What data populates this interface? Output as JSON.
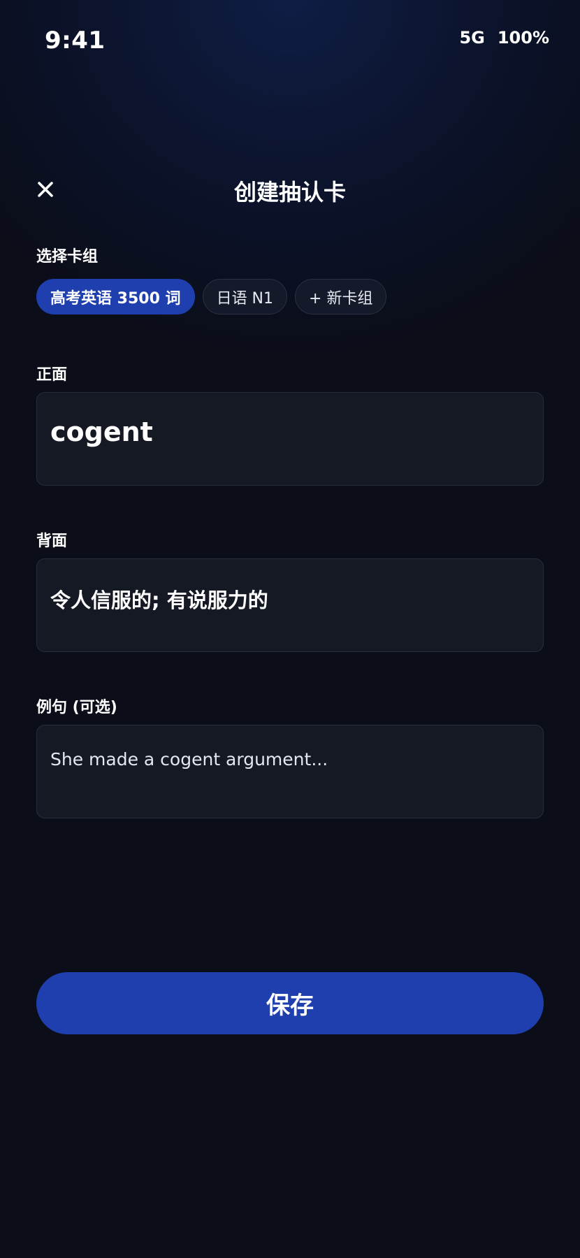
{
  "status_bar": {
    "time": "9:41",
    "network": "5G",
    "battery": "100%"
  },
  "header": {
    "close_icon": "close-icon",
    "title": "创建抽认卡"
  },
  "deck_section": {
    "label": "选择卡组",
    "chips": [
      {
        "label": "高考英语 3500 词",
        "selected": true
      },
      {
        "label": "日语 N1",
        "selected": false
      },
      {
        "label": "+ 新卡组",
        "selected": false
      }
    ]
  },
  "front": {
    "label": "正面",
    "value": "cogent"
  },
  "back": {
    "label": "背面",
    "value": "令人信服的; 有说服力的"
  },
  "example": {
    "label": "例句 (可选)",
    "value": "She made a cogent argument..."
  },
  "save_button": {
    "label": "保存"
  },
  "colors": {
    "background": "#0b0e18",
    "accent": "#1f3fae",
    "field_background": "#141924",
    "field_border": "#262d3b"
  }
}
